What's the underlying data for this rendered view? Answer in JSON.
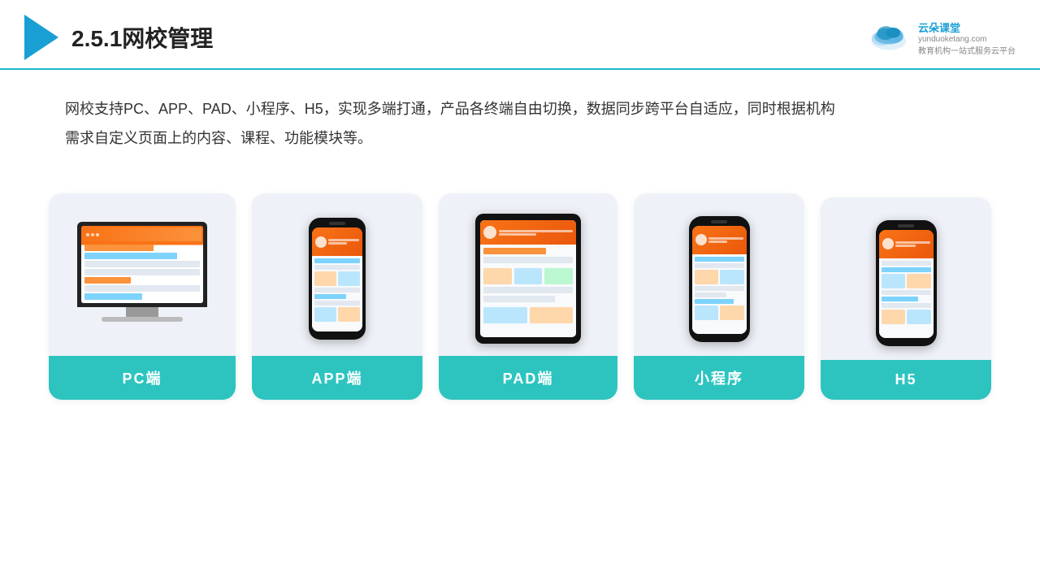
{
  "header": {
    "title": "2.5.1网校管理",
    "logo_name": "云朵课堂",
    "logo_domain": "yunduoketang.com",
    "logo_tagline": "教育机构一站\n式服务云平台"
  },
  "description": {
    "text": "网校支持PC、APP、PAD、小程序、H5，实现多端打通，产品各终端自由切换，数据同步跨平台自适应，同时根据机构\n需求自定义页面上的内容、课程、功能模块等。"
  },
  "cards": [
    {
      "id": "pc",
      "label": "PC端"
    },
    {
      "id": "app",
      "label": "APP端"
    },
    {
      "id": "pad",
      "label": "PAD端"
    },
    {
      "id": "miniprogram",
      "label": "小程序"
    },
    {
      "id": "h5",
      "label": "H5"
    }
  ]
}
